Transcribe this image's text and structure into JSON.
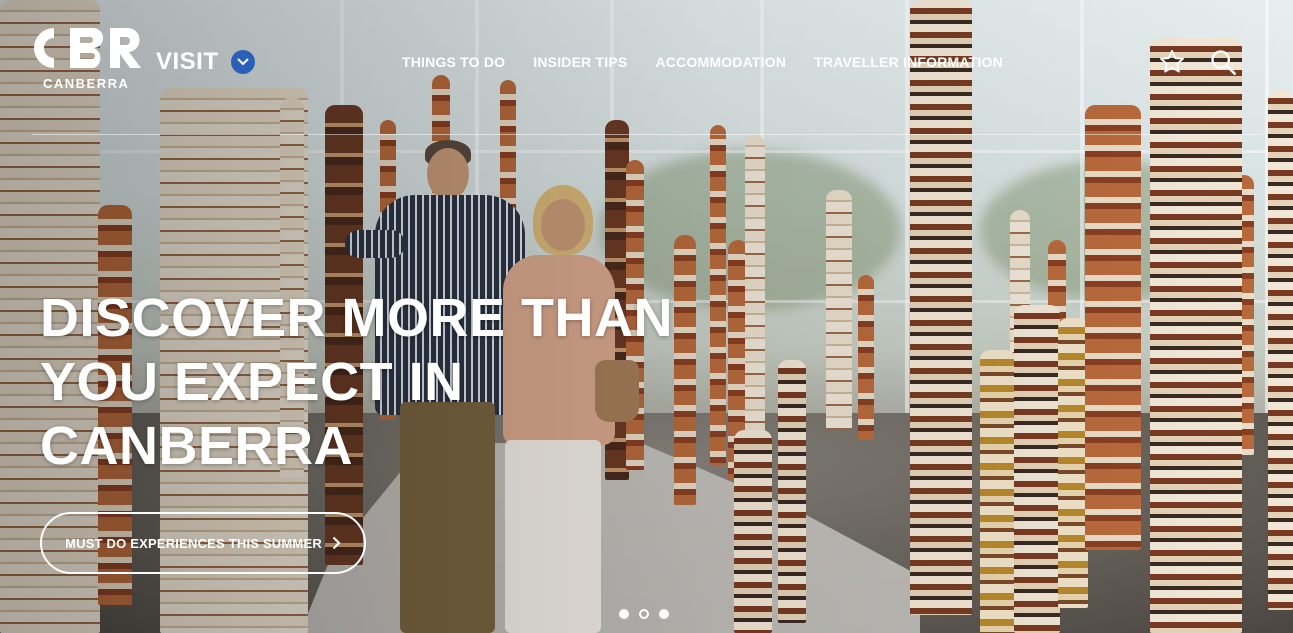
{
  "brand": {
    "logo_text": "CBR",
    "logo_subtext": "CANBERRA",
    "section_label": "VISIT"
  },
  "nav": {
    "items": [
      {
        "label": "THINGS TO DO"
      },
      {
        "label": "INSIDER TIPS"
      },
      {
        "label": "ACCOMMODATION"
      },
      {
        "label": "TRAVELLER INFORMATION"
      }
    ]
  },
  "icons": {
    "favourites": "star-icon",
    "search": "search-icon",
    "visit_dropdown": "chevron-down-icon",
    "cta_arrow": "chevron-right-icon"
  },
  "hero": {
    "headline_lines": [
      "DISCOVER MORE THAN",
      "YOU EXPECT IN",
      "CANBERRA"
    ],
    "cta_label": "MUST DO EXPERIENCES THIS SUMMER",
    "carousel": {
      "total_slides": 3,
      "active_slide": 1
    }
  },
  "colors": {
    "accent_blue": "#2a5fb8",
    "text": "#ffffff"
  }
}
